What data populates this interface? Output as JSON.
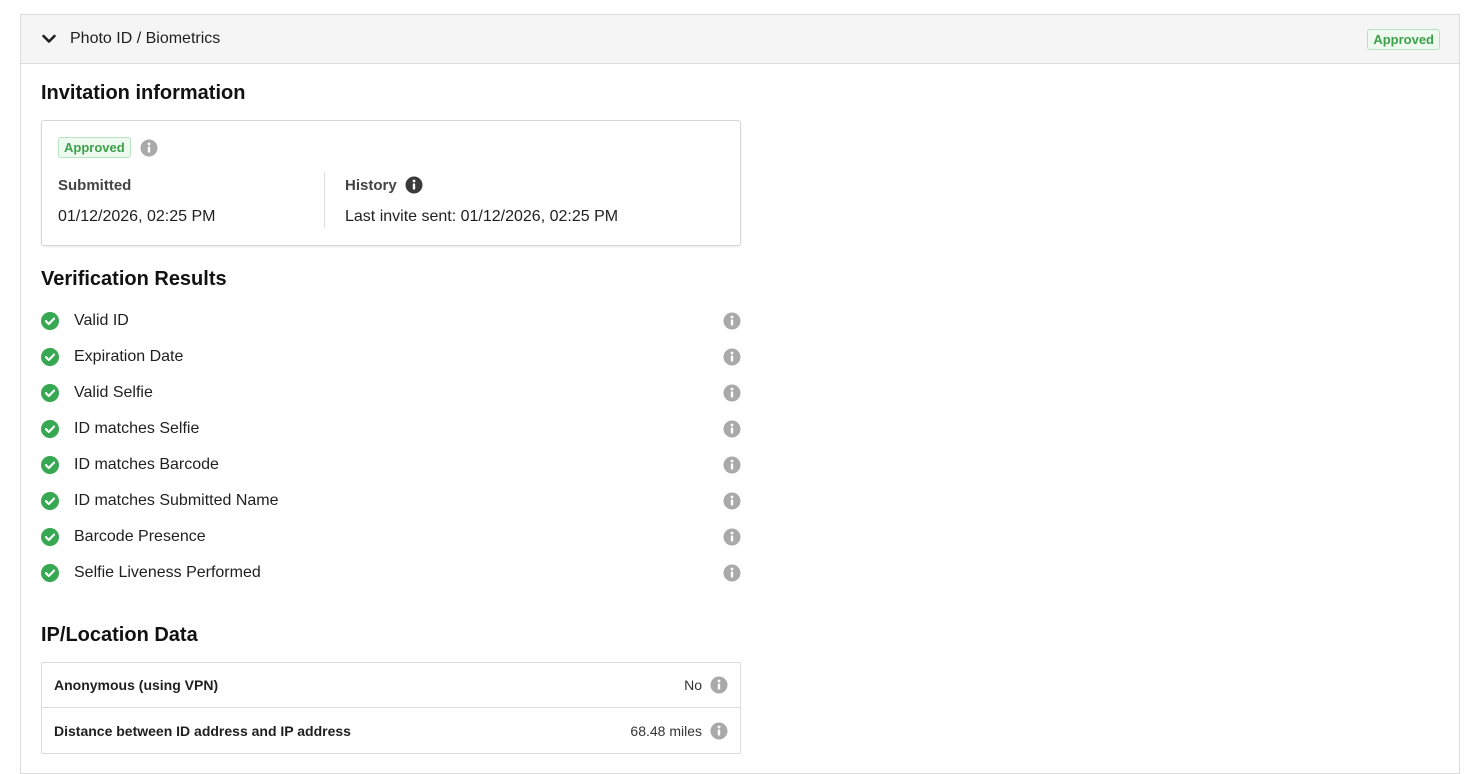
{
  "panel": {
    "title": "Photo ID / Biometrics",
    "status": "Approved"
  },
  "invitation": {
    "section_title": "Invitation information",
    "status": "Approved",
    "submitted_label": "Submitted",
    "submitted_value": "01/12/2026, 02:25 PM",
    "history_label": "History",
    "history_value": "Last invite sent: 01/12/2026, 02:25 PM"
  },
  "verification": {
    "section_title": "Verification Results",
    "items": [
      {
        "label": "Valid ID"
      },
      {
        "label": "Expiration Date"
      },
      {
        "label": "Valid Selfie"
      },
      {
        "label": "ID matches Selfie"
      },
      {
        "label": "ID matches Barcode"
      },
      {
        "label": "ID matches Submitted Name"
      },
      {
        "label": "Barcode Presence"
      },
      {
        "label": "Selfie Liveness Performed"
      }
    ]
  },
  "ip_location": {
    "section_title": "IP/Location Data",
    "rows": [
      {
        "label": "Anonymous (using VPN)",
        "value": "No"
      },
      {
        "label": "Distance between ID address and IP address",
        "value": "68.48 miles"
      }
    ]
  },
  "colors": {
    "approved_green": "#3da14a",
    "check_green": "#36a851",
    "info_grey": "#a9a9a9",
    "info_dark": "#3a3a3a"
  }
}
